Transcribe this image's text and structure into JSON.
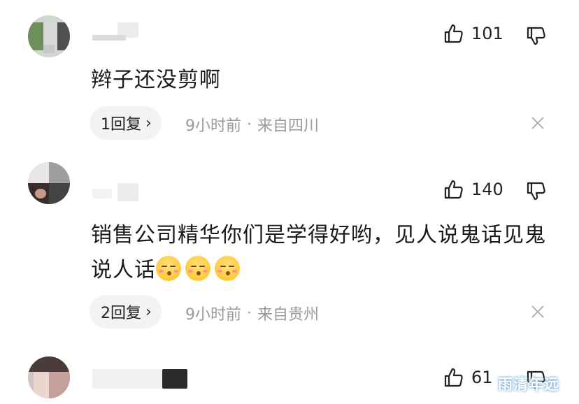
{
  "comments": [
    {
      "likes": "101",
      "text": "辫子还没剪啊",
      "reply_label": "1回复",
      "time": "9小时前",
      "location": "来自四川"
    },
    {
      "likes": "140",
      "text": "销售公司精华你们是学得好哟，见人说鬼话见鬼说人话",
      "reply_label": "2回复",
      "time": "9小时前",
      "location": "来自贵州"
    },
    {
      "likes": "61",
      "text": ""
    }
  ],
  "meta_separator": "·",
  "reply_chevron": "›",
  "watermark": "雨清年远",
  "icons": {
    "like": "thumbs-up-icon",
    "dislike": "thumbs-down-icon",
    "close": "close-icon",
    "emoji": "kissing-face-emoji"
  },
  "colors": {
    "meta_text": "#9a9a9a",
    "reply_pill": "#f3f3f3"
  }
}
